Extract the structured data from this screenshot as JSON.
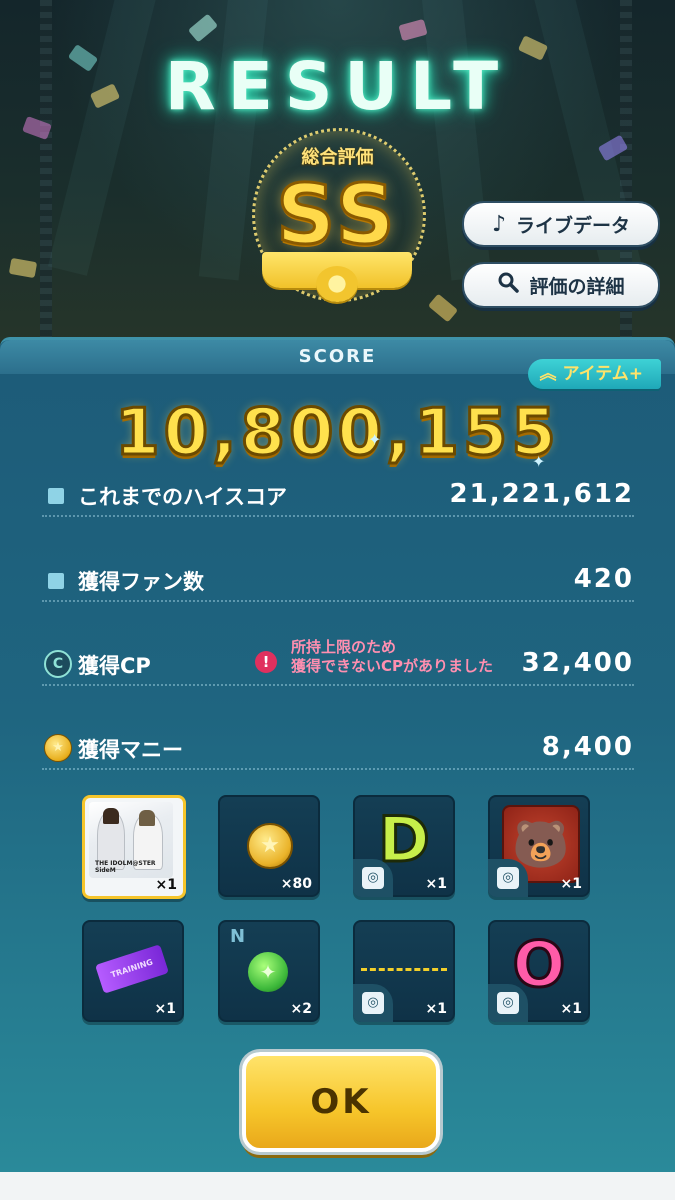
{
  "header": {
    "title": "RESULT",
    "rank_label": "総合評価",
    "rank_value": "SS"
  },
  "buttons": {
    "live_data": "ライブデータ",
    "eval_detail": "評価の詳細",
    "ok": "OK"
  },
  "score": {
    "section_label": "SCORE",
    "item_tab": "アイテム+",
    "total": "10,800,155"
  },
  "stats": {
    "high_score_label": "これまでのハイスコア",
    "high_score_value": "21,221,612",
    "fans_label": "獲得ファン数",
    "fans_value": "420",
    "cp_label": "獲得CP",
    "cp_value": "32,400",
    "cp_warning_line1": "所持上限のため",
    "cp_warning_line2": "獲得できないCPがありました",
    "money_label": "獲得マニー",
    "money_value": "8,400"
  },
  "rewards": [
    {
      "kind": "card",
      "qty": "×1",
      "caption": "THE IDOLM@STER SideM"
    },
    {
      "kind": "coin",
      "qty": "×80"
    },
    {
      "kind": "letter-D",
      "qty": "×1"
    },
    {
      "kind": "bear-emblem",
      "qty": "×1"
    },
    {
      "kind": "training-ticket",
      "qty": "×1",
      "caption": "TRAINING"
    },
    {
      "kind": "green-orb",
      "qty": "×2",
      "caption": "N"
    },
    {
      "kind": "dashed-line",
      "qty": "×1"
    },
    {
      "kind": "letter-O",
      "qty": "×1"
    }
  ],
  "icons": {
    "live_data": "music-note-icon",
    "eval_detail": "magnifier-icon",
    "cp": "c-badge-icon",
    "money": "coin-icon",
    "warning": "exclamation-icon",
    "item_tab": "double-chevron-up-icon"
  },
  "colors": {
    "gold": "#ffd94a",
    "panel": "#1f6580",
    "neon": "#59f0c8",
    "warning": "#e0305e"
  }
}
